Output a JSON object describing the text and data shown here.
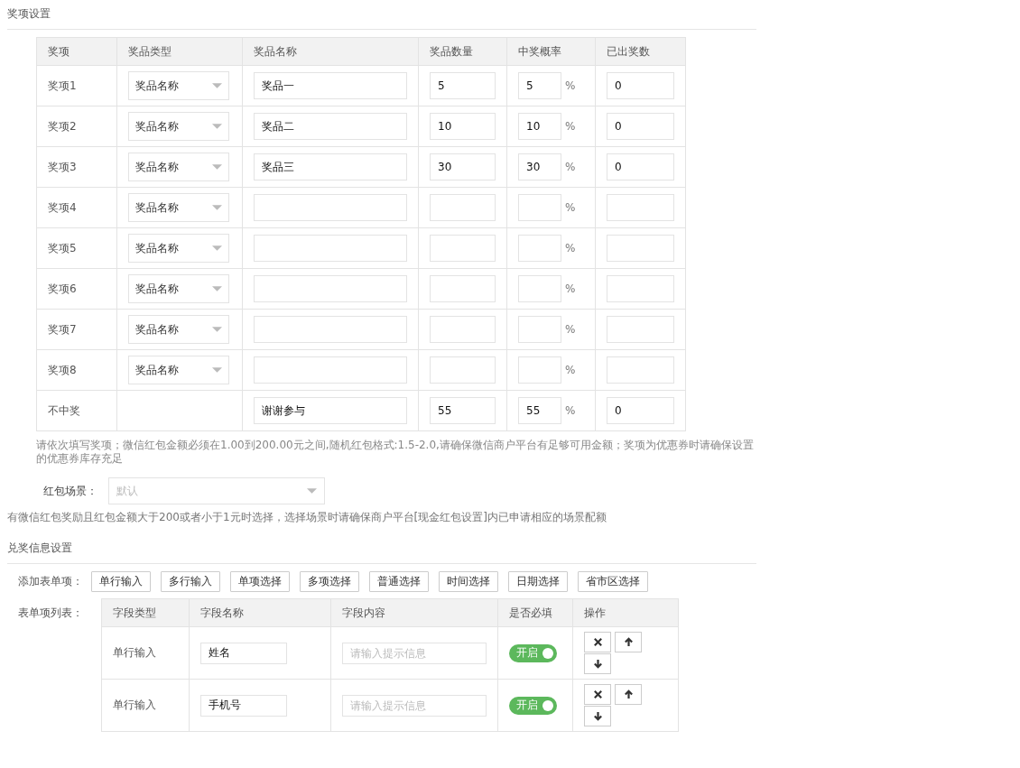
{
  "prize_section": {
    "title": "奖项设置"
  },
  "prize_table": {
    "columns": [
      "奖项",
      "奖品类型",
      "奖品名称",
      "奖品数量",
      "中奖概率",
      "已出奖数"
    ],
    "rows": [
      {
        "label": "奖项1",
        "type": "奖品名称",
        "name": "奖品一",
        "quantity": "5",
        "rate": "5",
        "unit": "%",
        "issued": "0"
      },
      {
        "label": "奖项2",
        "type": "奖品名称",
        "name": "奖品二",
        "quantity": "10",
        "rate": "10",
        "unit": "%",
        "issued": "0"
      },
      {
        "label": "奖项3",
        "type": "奖品名称",
        "name": "奖品三",
        "quantity": "30",
        "rate": "30",
        "unit": "%",
        "issued": "0"
      },
      {
        "label": "奖项4",
        "type": "奖品名称",
        "unit": "%"
      },
      {
        "label": "奖项5",
        "type": "奖品名称",
        "unit": "%"
      },
      {
        "label": "奖项6",
        "type": "奖品名称",
        "unit": "%"
      },
      {
        "label": "奖项7",
        "type": "奖品名称",
        "unit": "%"
      },
      {
        "label": "奖项8",
        "type": "奖品名称",
        "unit": "%"
      },
      {
        "label": "不中奖",
        "name": "谢谢参与",
        "quantity": "55",
        "rate": "55",
        "unit": "%",
        "issued": "0"
      }
    ]
  },
  "prize_note": "请依次填写奖项；微信红包金额必须在1.00到200.00元之间,随机红包格式:1.5-2.0,请确保微信商户平台有足够可用金额；奖项为优惠券时请确保设置的优惠券库存充足",
  "scene": {
    "label": "红包场景：",
    "placeholder": "默认",
    "note": "有微信红包奖励且红包金额大于200或者小于1元时选择，选择场景时请确保商户平台[现金红包设置]内已申请相应的场景配额"
  },
  "redeem_section": {
    "title": "兑奖信息设置"
  },
  "add_items": {
    "label": "添加表单项：",
    "buttons": [
      "单行输入",
      "多行输入",
      "单项选择",
      "多项选择",
      "普通选择",
      "时间选择",
      "日期选择",
      "省市区选择"
    ]
  },
  "field_table": {
    "label": "表单项列表：",
    "columns": [
      "字段类型",
      "字段名称",
      "字段内容",
      "是否必填",
      "操作"
    ],
    "rows": [
      {
        "type": "单行输入",
        "name": "姓名",
        "placeholder": "请输入提示信息",
        "required": true,
        "toggle_label": "开启"
      },
      {
        "type": "单行输入",
        "name": "手机号",
        "placeholder": "请输入提示信息",
        "required": true,
        "toggle_label": "开启"
      }
    ]
  }
}
